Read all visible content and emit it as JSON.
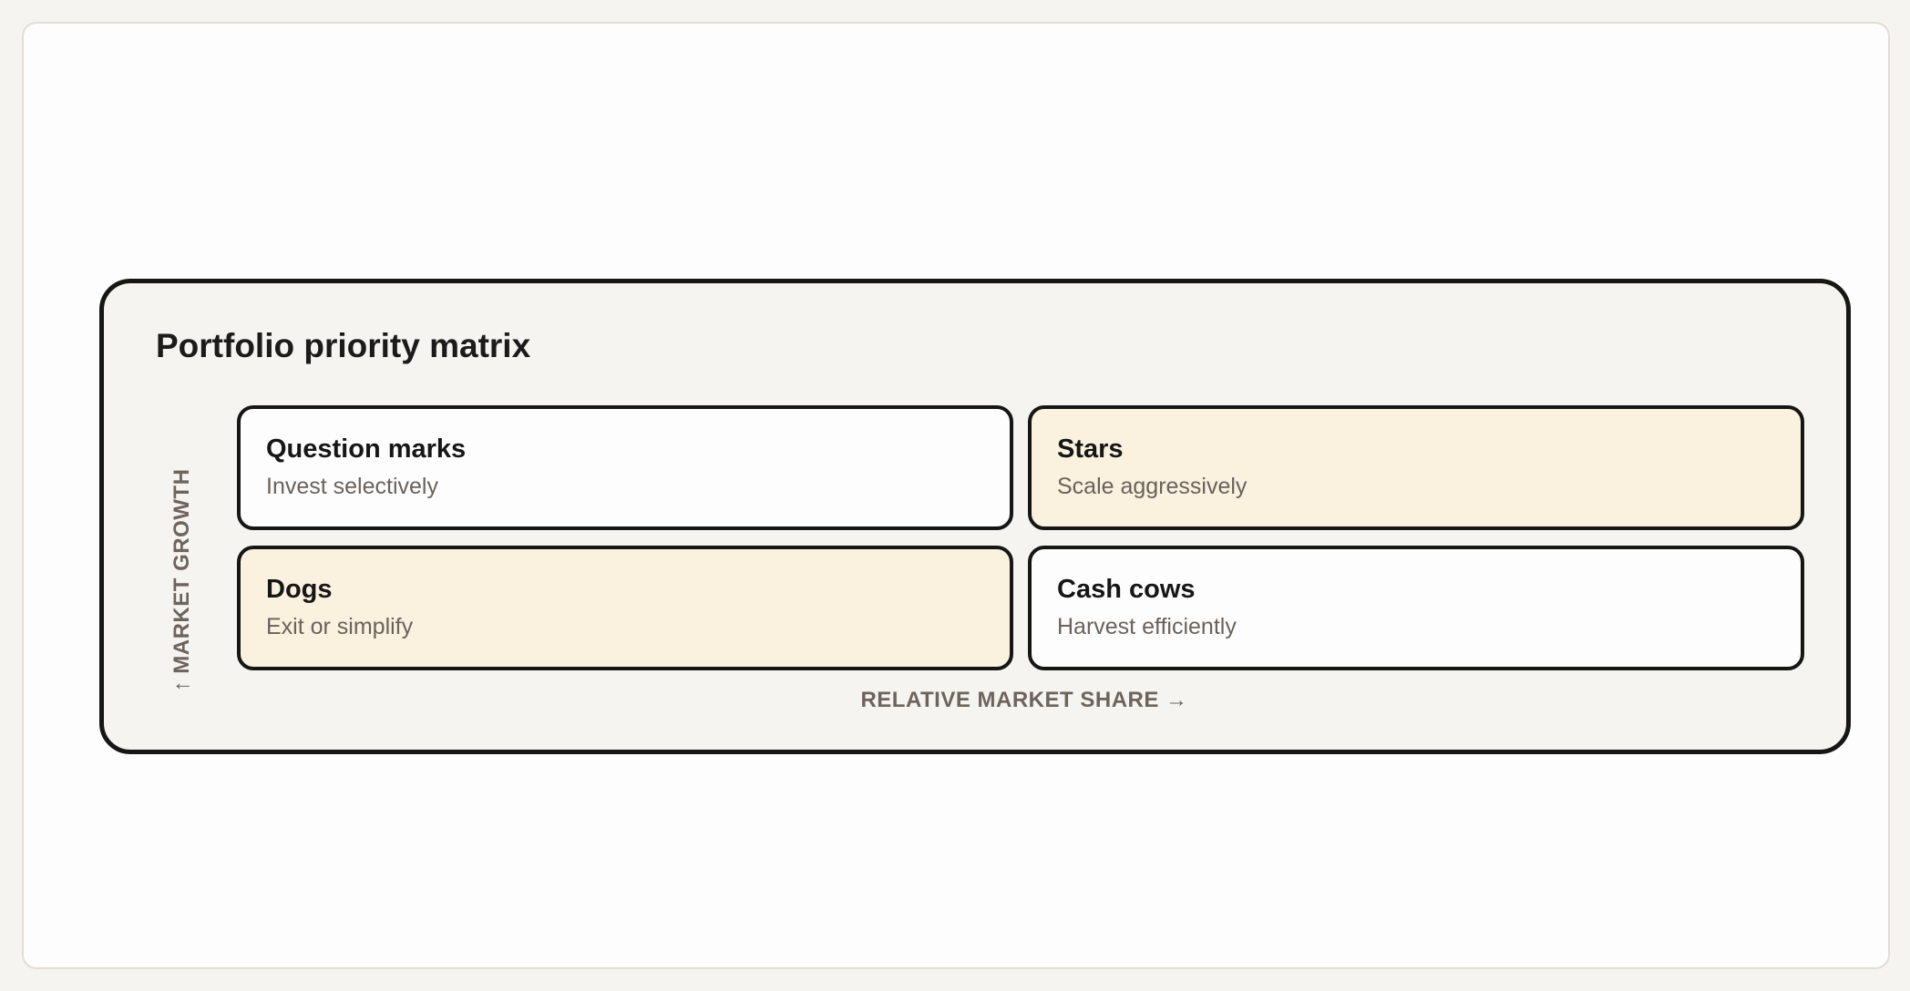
{
  "matrix": {
    "title": "Portfolio priority matrix",
    "y_axis_label": "↑ MARKET GROWTH",
    "x_axis_label": "RELATIVE MARKET SHARE →",
    "quadrants": [
      {
        "title": "Question marks",
        "description": "Invest selectively",
        "fill": "#fdfdfd"
      },
      {
        "title": "Stars",
        "description": "Scale aggressively",
        "fill": "#faf1df"
      },
      {
        "title": "Dogs",
        "description": "Exit or simplify",
        "fill": "#faf1df"
      },
      {
        "title": "Cash cows",
        "description": "Harvest efficiently",
        "fill": "#fdfdfd"
      }
    ]
  },
  "colors": {
    "background": "#f6f4f0",
    "card": "#f5f4f0",
    "border": "#161616",
    "muted_text": "#6d645c",
    "highlight": "#faf1df"
  }
}
